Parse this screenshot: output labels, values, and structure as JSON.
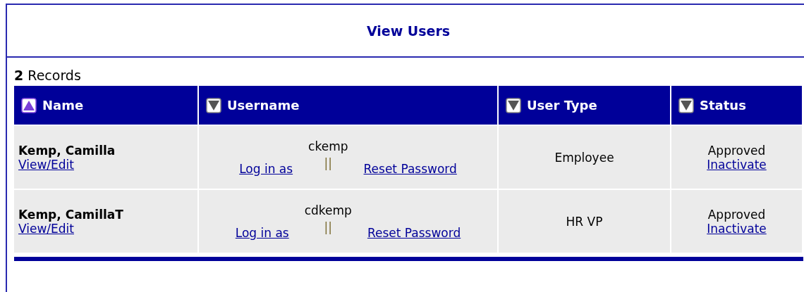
{
  "title": "View Users",
  "record_count": {
    "count": "2",
    "label": "Records"
  },
  "table": {
    "columns": [
      {
        "label": "Name",
        "selected": true
      },
      {
        "label": "Username",
        "selected": false
      },
      {
        "label": "User Type",
        "selected": false
      },
      {
        "label": "Status",
        "selected": false
      }
    ],
    "rows": [
      {
        "name": "Kemp, Camilla",
        "edit_link": "View/Edit",
        "username": "ckemp",
        "login_link": "Log in as",
        "separator": "||",
        "reset_link": "Reset Password",
        "user_type": "Employee",
        "status": "Approved",
        "status_link": "Inactivate"
      },
      {
        "name": "Kemp, CamillaT",
        "edit_link": "View/Edit",
        "username": "cdkemp",
        "login_link": "Log in as",
        "separator": "||",
        "reset_link": "Reset Password",
        "user_type": "HR VP",
        "status": "Approved",
        "status_link": "Inactivate"
      }
    ]
  }
}
